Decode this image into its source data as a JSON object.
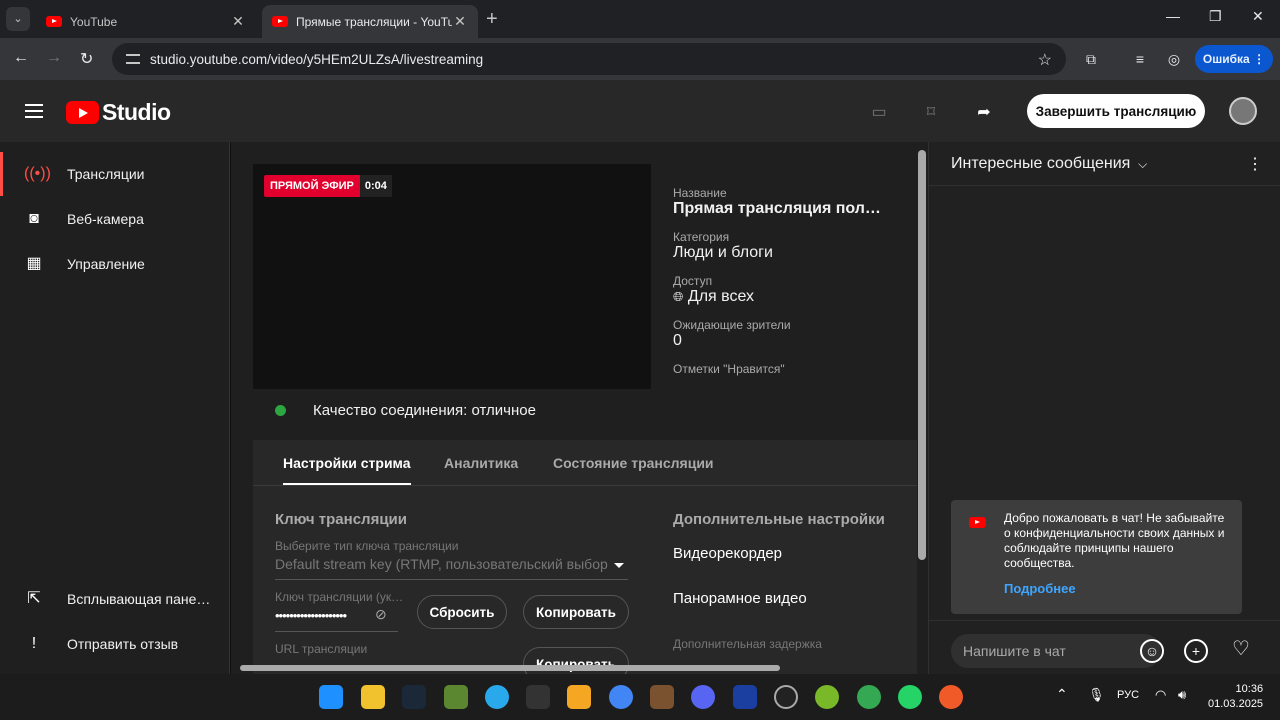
{
  "browser": {
    "tabs": [
      {
        "title": "YouTube"
      },
      {
        "title": "Прямые трансляции - YouTube"
      }
    ],
    "url": "studio.youtube.com/video/y5HEm2ULZsA/livestreaming",
    "error_button": "Ошибка"
  },
  "header": {
    "logo_text": "Studio",
    "end_stream_label": "Завершить трансляцию"
  },
  "sidebar": {
    "items": [
      {
        "label": "Трансляции",
        "icon": "broadcast-icon"
      },
      {
        "label": "Веб-камера",
        "icon": "camera-icon"
      },
      {
        "label": "Управление",
        "icon": "calendar-icon"
      }
    ],
    "bottom": [
      {
        "label": "Всплывающая пане…",
        "icon": "popout-icon"
      },
      {
        "label": "Отправить отзыв",
        "icon": "feedback-icon"
      }
    ]
  },
  "preview": {
    "live_label": "ПРЯМОЙ ЭФИР",
    "time": "0:04"
  },
  "info": {
    "title_label": "Название",
    "title_value": "Прямая трансляция пол…",
    "category_label": "Категория",
    "category_value": "Люди и блоги",
    "access_label": "Доступ",
    "access_value": "Для всех",
    "waiting_label": "Ожидающие зрители",
    "waiting_value": "0",
    "likes_label": "Отметки \"Нравится\""
  },
  "connection": {
    "text": "Качество соединения: отличное",
    "status_color": "#2ba640"
  },
  "panel": {
    "tabs": [
      "Настройки стрима",
      "Аналитика",
      "Состояние трансляции"
    ],
    "key_section_title": "Ключ трансляции",
    "key_type_label": "Выберите тип ключа трансляции",
    "key_type_value": "Default stream key (RTMP, пользовательский выбор",
    "key_label": "Ключ трансляции (ук…",
    "key_value": "••••••••••••••••••••",
    "reset_label": "Сбросить",
    "copy_label": "Копировать",
    "url_label": "URL трансляции",
    "copy_url_label": "Копировать",
    "advanced_title": "Дополнительные настройки",
    "dvr_label": "Видеорекордер",
    "panoramic_label": "Панорамное видео",
    "delay_label": "Дополнительная задержка"
  },
  "chat": {
    "title": "Интересные сообщения",
    "welcome_text": "Добро пожаловать в чат! Не забывайте о конфиденциальности своих данных и соблюдайте принципы нашего сообщества.",
    "learn_more": "Подробнее",
    "input_placeholder": "Напишите в чат"
  },
  "taskbar": {
    "language": "РУС",
    "time": "10:36",
    "date": "01.03.2025"
  },
  "colors": {
    "accent_red": "#ff0000",
    "link_blue": "#3ea6ff",
    "live_red": "#e1002d"
  }
}
